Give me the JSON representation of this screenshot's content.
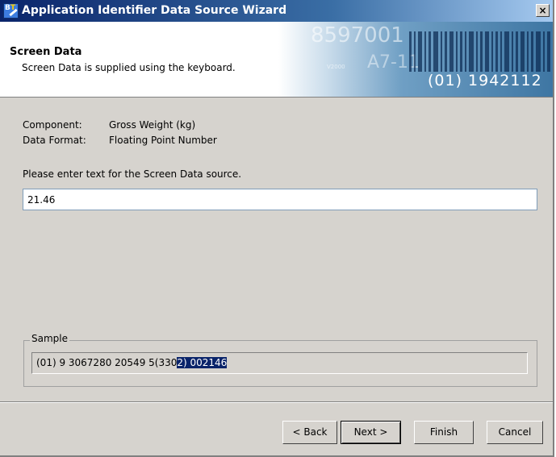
{
  "window": {
    "title": "Application Identifier Data Source Wizard",
    "close_glyph": "×"
  },
  "header": {
    "title": "Screen Data",
    "subtitle": "Screen Data is supplied using the keyboard.",
    "banner_code": "(01) 1942112",
    "banner_ghost_1": "8597001",
    "banner_ghost_2": "A7-11",
    "banner_ghost_3": "V2000"
  },
  "info": {
    "component_label": "Component:",
    "component_value": "Gross Weight (kg)",
    "format_label": "Data Format:",
    "format_value": "Floating Point Number"
  },
  "prompt": "Please enter text for the Screen Data source.",
  "input": {
    "value": "21.46"
  },
  "sample": {
    "legend": "Sample",
    "text_plain": "(01) 9 3067280 20549 5(330",
    "text_selected": "2) 002146"
  },
  "buttons": {
    "back": "< Back",
    "next": "Next >",
    "finish": "Finish",
    "cancel": "Cancel"
  },
  "colors": {
    "title_bar": "#0a246a",
    "selection": "#0a246a",
    "face": "#d6d3ce"
  },
  "icons": {
    "app": "app-logo-icon"
  }
}
